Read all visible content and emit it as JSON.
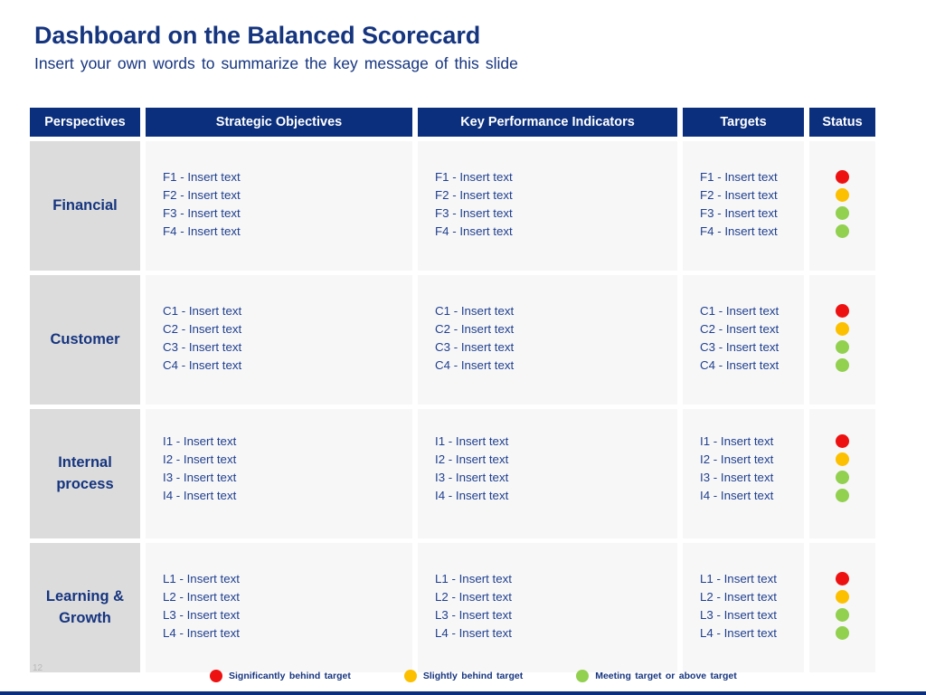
{
  "slide": {
    "title": "Dashboard on the Balanced Scorecard",
    "subtitle": "Insert your own words to summarize the key message of this slide",
    "page_number": "12",
    "colors": {
      "navy": "#0b2f7d",
      "title_blue": "#16357f",
      "body_blue": "#1f3f8f",
      "perspective_bg": "#dcdcdc",
      "cell_bg": "#f7f7f7",
      "red": "#ee1111",
      "amber": "#fcc000",
      "green": "#92d050"
    }
  },
  "table": {
    "headers": [
      {
        "label": "Perspectives"
      },
      {
        "label": "Strategic Objectives"
      },
      {
        "label": "Key Performance Indicators"
      },
      {
        "label": "Targets"
      },
      {
        "label": "Status"
      }
    ],
    "rows": [
      {
        "perspective": "Financial",
        "objectives": [
          "F1 - Insert text",
          "F2 - Insert text",
          "F3 - Insert text",
          "F4 - Insert text"
        ],
        "kpis": [
          "F1 - Insert text",
          "F2 - Insert text",
          "F3 - Insert text",
          "F4 - Insert text"
        ],
        "targets": [
          "F1 - Insert text",
          "F2 - Insert text",
          "F3 - Insert text",
          "F4 - Insert text"
        ],
        "status": [
          "red",
          "amber",
          "green",
          "green"
        ]
      },
      {
        "perspective": "Customer",
        "objectives": [
          "C1 - Insert text",
          "C2 - Insert text",
          "C3 - Insert text",
          "C4 - Insert text"
        ],
        "kpis": [
          "C1 - Insert text",
          "C2 - Insert text",
          "C3 - Insert text",
          "C4 - Insert text"
        ],
        "targets": [
          "C1 - Insert text",
          "C2 - Insert text",
          "C3 - Insert text",
          "C4 - Insert text"
        ],
        "status": [
          "red",
          "amber",
          "green",
          "green"
        ]
      },
      {
        "perspective": "Internal process",
        "objectives": [
          "I1 - Insert text",
          "I2 - Insert text",
          "I3 - Insert text",
          "I4 - Insert text"
        ],
        "kpis": [
          "I1 - Insert text",
          "I2 - Insert text",
          "I3 - Insert text",
          "I4 - Insert text"
        ],
        "targets": [
          "I1 - Insert text",
          "I2 - Insert text",
          "I3 - Insert text",
          "I4 - Insert text"
        ],
        "status": [
          "red",
          "amber",
          "green",
          "green"
        ]
      },
      {
        "perspective": "Learning & Growth",
        "objectives": [
          "L1 - Insert text",
          "L2 - Insert text",
          "L3 - Insert text",
          "L4 - Insert text"
        ],
        "kpis": [
          "L1 - Insert text",
          "L2 - Insert text",
          "L3 - Insert text",
          "L4 - Insert text"
        ],
        "targets": [
          "L1 - Insert text",
          "L2 - Insert text",
          "L3 - Insert text",
          "L4 - Insert text"
        ],
        "status": [
          "red",
          "amber",
          "green",
          "green"
        ]
      }
    ]
  },
  "legend": [
    {
      "color_key": "red",
      "color": "#ee1111",
      "label": "Significantly behind target"
    },
    {
      "color_key": "amber",
      "color": "#fcc000",
      "label": "Slightly behind target"
    },
    {
      "color_key": "green",
      "color": "#92d050",
      "label": "Meeting target or above target"
    }
  ]
}
